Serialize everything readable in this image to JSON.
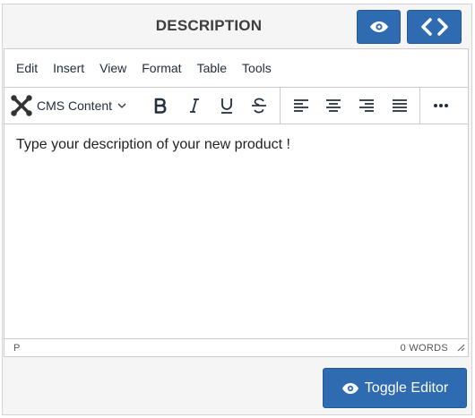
{
  "header": {
    "title": "DESCRIPTION"
  },
  "icons": {
    "preview": "eye-icon",
    "code": "code-icon",
    "joomla": "joomla-logo-icon"
  },
  "menubar": {
    "items": [
      "Edit",
      "Insert",
      "View",
      "Format",
      "Table",
      "Tools"
    ]
  },
  "toolbar": {
    "cms_select": "CMS Content",
    "buttons": [
      "bold",
      "italic",
      "underline",
      "strikethrough",
      "align-left",
      "align-center",
      "align-right",
      "align-justify",
      "more"
    ]
  },
  "content": {
    "text": "Type your description of your new product !"
  },
  "statusbar": {
    "path": "P",
    "words": "0 WORDS"
  },
  "footer": {
    "toggle_label": "Toggle Editor"
  },
  "colors": {
    "accent": "#2e6bb0",
    "text": "#222f3e"
  }
}
